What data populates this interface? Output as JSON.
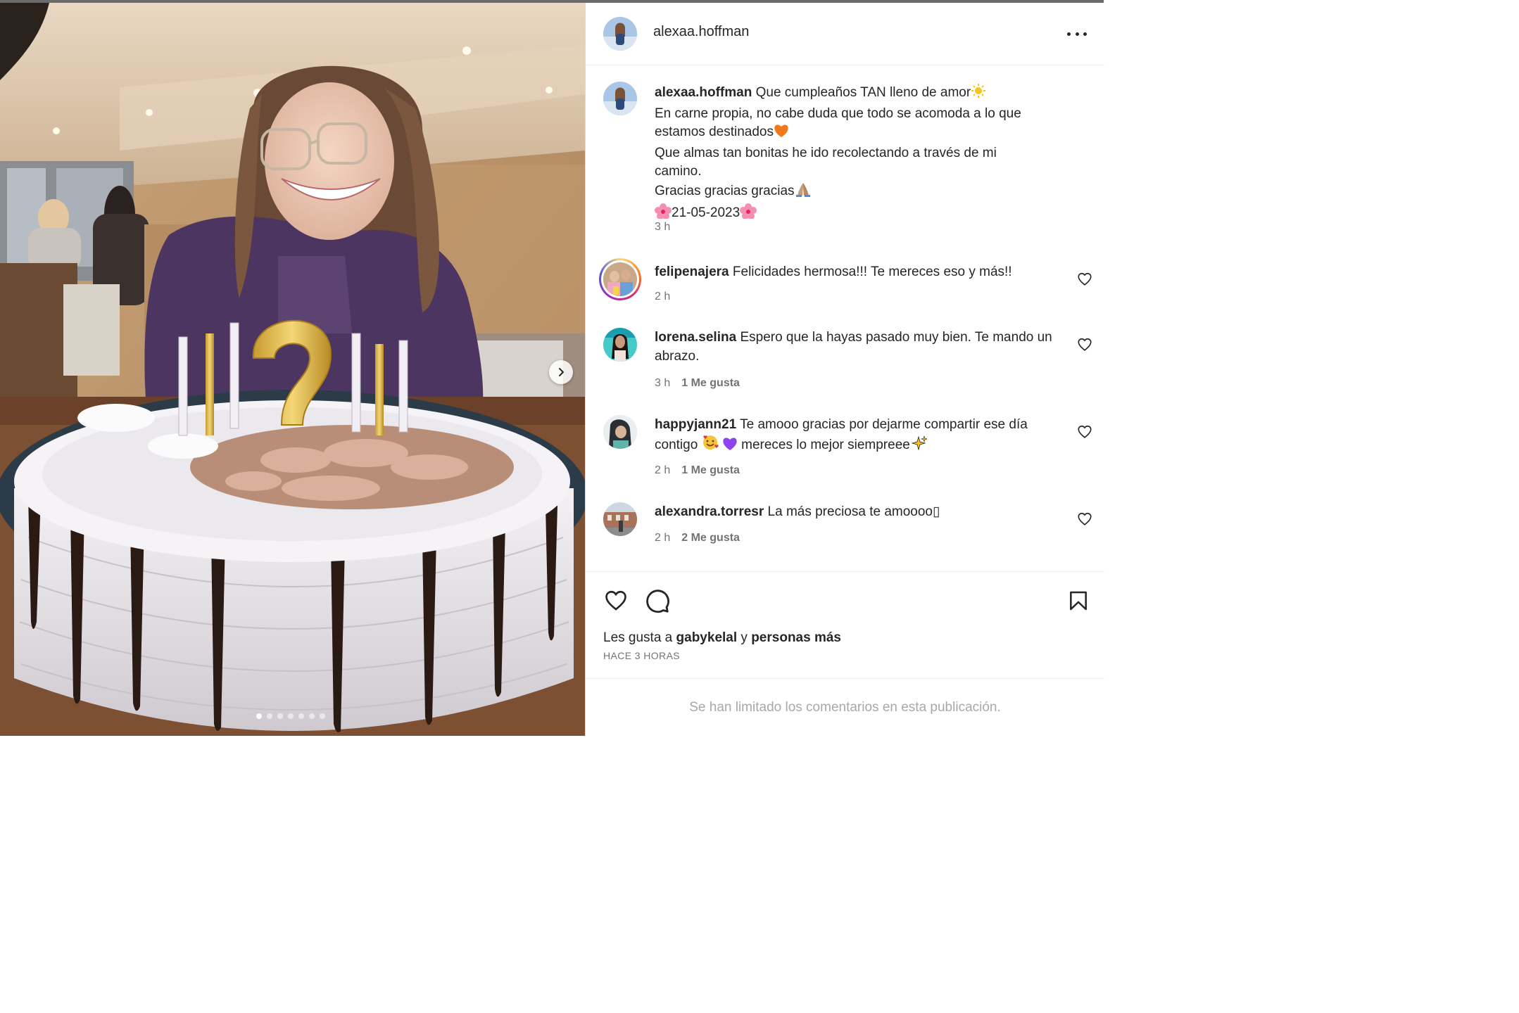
{
  "post": {
    "author": "alexaa.hoffman",
    "more_label": "More options",
    "photo_alt": "Birthday photo with cake and candles",
    "carousel": {
      "count": 7,
      "active_index": 0,
      "next_label": "Next"
    }
  },
  "caption": {
    "username": "alexaa.hoffman",
    "lines": [
      "Que cumpleaños TAN lleno de amor",
      "En carne propia, no cabe duda que todo se acomoda a lo que",
      "estamos destinados",
      "Que almas tan bonitas he ido recolectando a través de mi",
      "camino.",
      "Gracias gracias gracias",
      "21-05-2023"
    ],
    "time": "3 h"
  },
  "comments": [
    {
      "username": "felipenajera",
      "text": "Felicidades hermosa!!! Te mereces eso y más!!",
      "time": "2 h",
      "likes": "",
      "has_story": true
    },
    {
      "username": "lorena.selina",
      "text": "Espero que la hayas pasado muy bien. Te mando un abrazo.",
      "time": "3 h",
      "likes": "1 Me gusta",
      "has_story": false
    },
    {
      "username": "happyjann21",
      "text_a": "Te amooo gracias por dejarme compartir ese día contigo",
      "text_b": "mereces lo mejor siempreee",
      "time": "2 h",
      "likes": "1 Me gusta",
      "has_story": false
    },
    {
      "username": "alexandra.torresr",
      "text": "La más preciosa te amoooo▯",
      "time": "2 h",
      "likes": "2 Me gusta",
      "has_story": false
    }
  ],
  "likes_summary": {
    "prefix": "Les gusta a",
    "user": "gabykelal",
    "connector": "y",
    "others": "personas más"
  },
  "timestamp": "HACE 3 HORAS",
  "comments_limited": "Se han limitado los comentarios en esta publicación.",
  "colors": {
    "text": "#262626",
    "muted": "#737373",
    "placeholder": "#a8a8a8",
    "divider": "#efefef"
  },
  "icons": [
    "more-icon",
    "carousel-next-icon",
    "heart-icon",
    "comment-icon",
    "bookmark-icon",
    "sun-emoji",
    "orange-heart-emoji",
    "pray-emoji",
    "blossom-emoji",
    "smiling-hearts-emoji",
    "purple-heart-emoji",
    "sparkles-emoji"
  ]
}
